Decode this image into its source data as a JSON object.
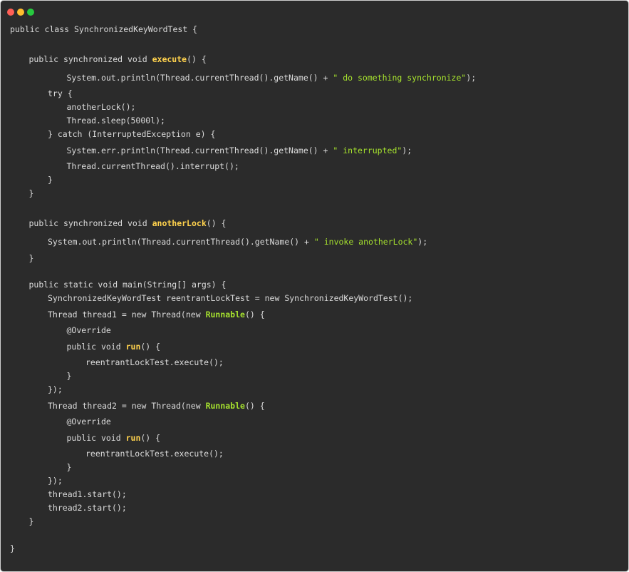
{
  "window": {
    "controls": [
      {
        "name": "close",
        "color": "#ff5f56"
      },
      {
        "name": "minimize",
        "color": "#ffbd2e"
      },
      {
        "name": "zoom",
        "color": "#27c93f"
      }
    ]
  },
  "colors": {
    "background": "#2b2b2b",
    "text": "#dcdcdc",
    "method_name": "#ffd24d",
    "class_ref": "#a6e22e",
    "string": "#a6e22e"
  },
  "code": {
    "lines": [
      {
        "indent": 0,
        "tokens": [
          {
            "t": "public class SynchronizedKeyWordTest {",
            "k": "plain"
          }
        ]
      },
      {
        "indent": 1,
        "tokens": [
          {
            "t": "public synchronized void ",
            "k": "plain"
          },
          {
            "t": "execute",
            "k": "fn"
          },
          {
            "t": "() {",
            "k": "plain"
          }
        ]
      },
      {
        "indent": 3,
        "tokens": [
          {
            "t": "System.out.println(Thread.currentThread().getName() + ",
            "k": "plain"
          },
          {
            "t": "\" do something synchronize\"",
            "k": "str"
          },
          {
            "t": ");",
            "k": "plain"
          }
        ]
      },
      {
        "indent": 2,
        "tokens": [
          {
            "t": "try {",
            "k": "plain"
          }
        ]
      },
      {
        "indent": 3,
        "tokens": [
          {
            "t": "anotherLock();",
            "k": "plain"
          }
        ]
      },
      {
        "indent": 3,
        "tokens": [
          {
            "t": "Thread.sleep(5000l);",
            "k": "plain"
          }
        ]
      },
      {
        "indent": 2,
        "tokens": [
          {
            "t": "} catch (InterruptedException e) {",
            "k": "plain"
          }
        ]
      },
      {
        "indent": 3,
        "tokens": [
          {
            "t": "System.err.println(Thread.currentThread().getName() + ",
            "k": "plain"
          },
          {
            "t": "\" interrupted\"",
            "k": "str"
          },
          {
            "t": ");",
            "k": "plain"
          }
        ]
      },
      {
        "indent": 3,
        "tokens": [
          {
            "t": "Thread.currentThread().interrupt();",
            "k": "plain"
          }
        ]
      },
      {
        "indent": 2,
        "tokens": [
          {
            "t": "}",
            "k": "plain"
          }
        ]
      },
      {
        "indent": 1,
        "tokens": [
          {
            "t": "}",
            "k": "plain"
          }
        ]
      },
      {
        "indent": 1,
        "tokens": [
          {
            "t": "public synchronized void ",
            "k": "plain"
          },
          {
            "t": "anotherLock",
            "k": "fn"
          },
          {
            "t": "() {",
            "k": "plain"
          }
        ]
      },
      {
        "indent": 2,
        "tokens": [
          {
            "t": "System.out.println(Thread.currentThread().getName() + ",
            "k": "plain"
          },
          {
            "t": "\" invoke anotherLock\"",
            "k": "str"
          },
          {
            "t": ");",
            "k": "plain"
          }
        ]
      },
      {
        "indent": 1,
        "tokens": [
          {
            "t": "}",
            "k": "plain"
          }
        ]
      },
      {
        "indent": 1,
        "tokens": [
          {
            "t": "public static void main(String[] args) {",
            "k": "plain"
          }
        ]
      },
      {
        "indent": 2,
        "tokens": [
          {
            "t": "SynchronizedKeyWordTest reentrantLockTest = new SynchronizedKeyWordTest();",
            "k": "plain"
          }
        ]
      },
      {
        "indent": 2,
        "tokens": [
          {
            "t": "Thread thread1 = new Thread(new ",
            "k": "plain"
          },
          {
            "t": "Runnable",
            "k": "type"
          },
          {
            "t": "() {",
            "k": "plain"
          }
        ]
      },
      {
        "indent": 3,
        "tokens": [
          {
            "t": "@Override",
            "k": "plain"
          }
        ]
      },
      {
        "indent": 3,
        "tokens": [
          {
            "t": "public void ",
            "k": "plain"
          },
          {
            "t": "run",
            "k": "fn"
          },
          {
            "t": "() {",
            "k": "plain"
          }
        ]
      },
      {
        "indent": 4,
        "tokens": [
          {
            "t": "reentrantLockTest.execute();",
            "k": "plain"
          }
        ]
      },
      {
        "indent": 3,
        "tokens": [
          {
            "t": "}",
            "k": "plain"
          }
        ]
      },
      {
        "indent": 2,
        "tokens": [
          {
            "t": "});",
            "k": "plain"
          }
        ]
      },
      {
        "indent": 2,
        "tokens": [
          {
            "t": "Thread thread2 = new Thread(new ",
            "k": "plain"
          },
          {
            "t": "Runnable",
            "k": "type"
          },
          {
            "t": "() {",
            "k": "plain"
          }
        ]
      },
      {
        "indent": 3,
        "tokens": [
          {
            "t": "@Override",
            "k": "plain"
          }
        ]
      },
      {
        "indent": 3,
        "tokens": [
          {
            "t": "public void ",
            "k": "plain"
          },
          {
            "t": "run",
            "k": "fn"
          },
          {
            "t": "() {",
            "k": "plain"
          }
        ]
      },
      {
        "indent": 4,
        "tokens": [
          {
            "t": "reentrantLockTest.execute();",
            "k": "plain"
          }
        ]
      },
      {
        "indent": 3,
        "tokens": [
          {
            "t": "}",
            "k": "plain"
          }
        ]
      },
      {
        "indent": 2,
        "tokens": [
          {
            "t": "});",
            "k": "plain"
          }
        ]
      },
      {
        "indent": 2,
        "tokens": [
          {
            "t": "thread1.start();",
            "k": "plain"
          }
        ]
      },
      {
        "indent": 2,
        "tokens": [
          {
            "t": "thread2.start();",
            "k": "plain"
          }
        ]
      },
      {
        "indent": 1,
        "tokens": [
          {
            "t": "}",
            "k": "plain"
          }
        ]
      },
      {
        "indent": 0,
        "tokens": [
          {
            "t": "}",
            "k": "plain"
          }
        ]
      }
    ]
  }
}
